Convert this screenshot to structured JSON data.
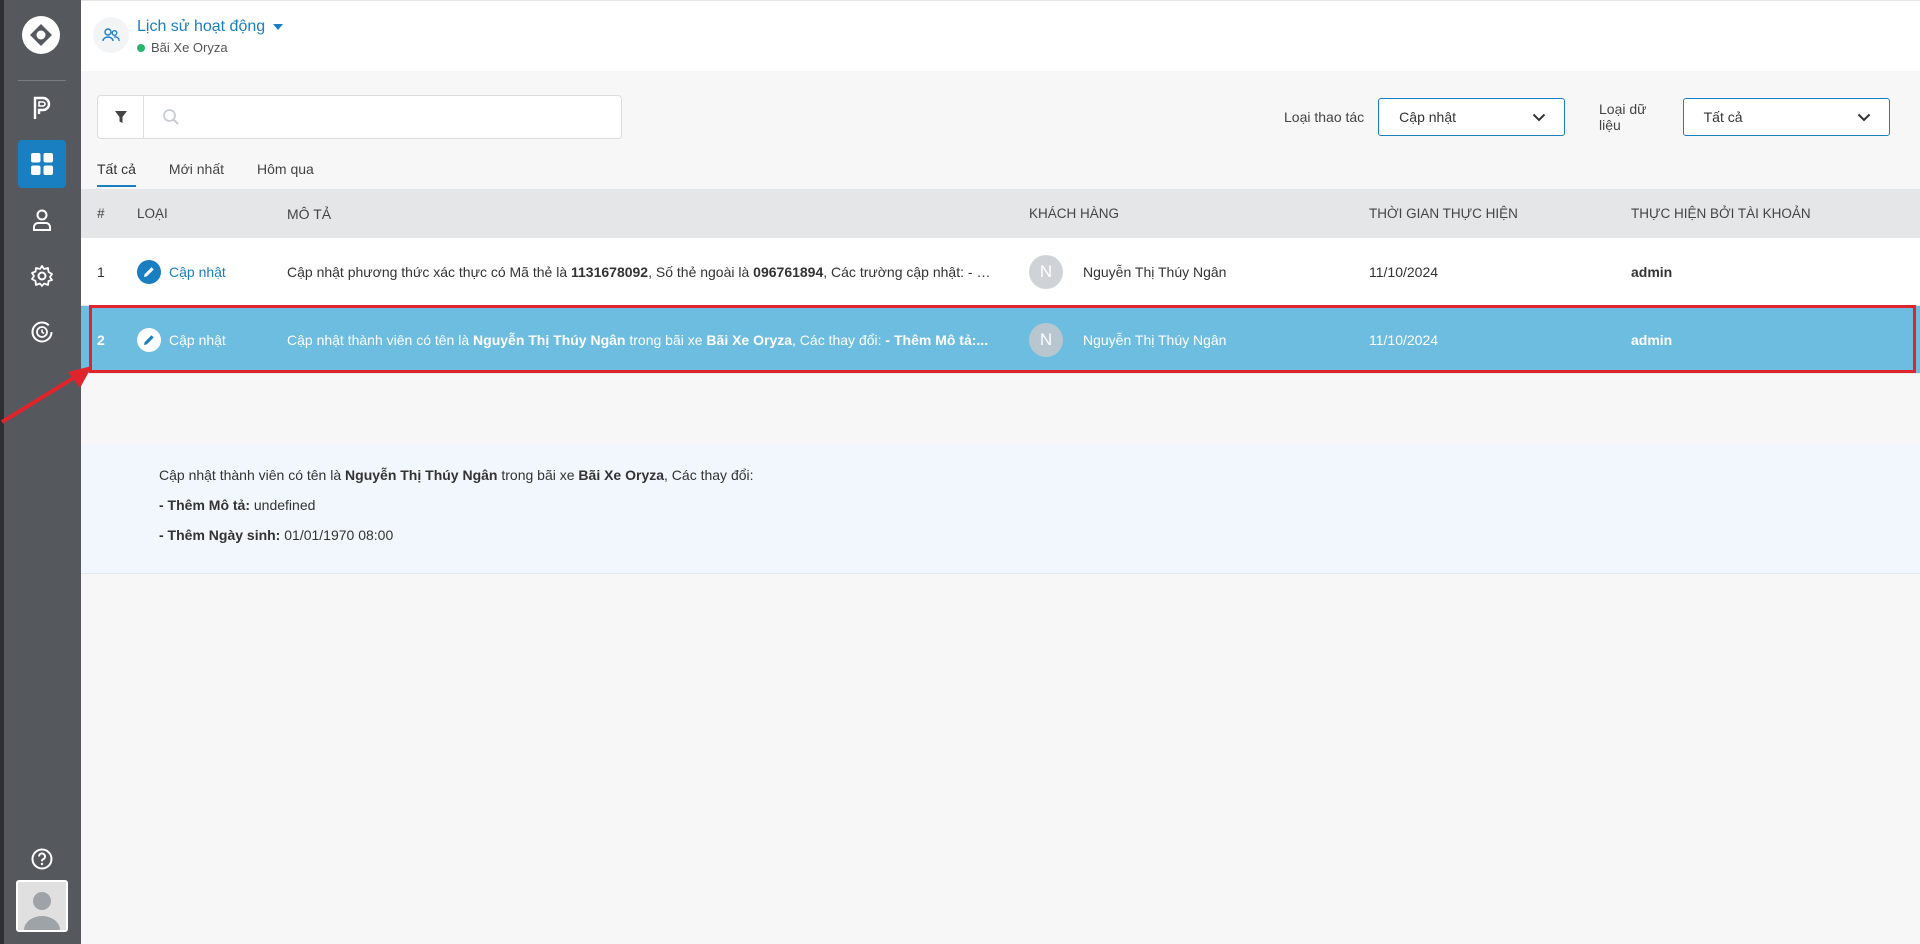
{
  "header": {
    "title": "Lịch sử hoạt động",
    "subtitle": "Bãi Xe Oryza"
  },
  "toolbar": {
    "search_placeholder": "",
    "filter_action_label": "Loại thao tác",
    "filter_action_value": "Cập nhật",
    "filter_data_label": "Loại dữ liệu",
    "filter_data_value": "Tất cả"
  },
  "tabs": [
    {
      "label": "Tất cả",
      "active": true
    },
    {
      "label": "Mới nhất",
      "active": false
    },
    {
      "label": "Hôm qua",
      "active": false
    }
  ],
  "table": {
    "columns": [
      "#",
      "LOẠI",
      "MÔ TẢ",
      "KHÁCH HÀNG",
      "THỜI GIAN THỰC HIỆN",
      "THỰC HIỆN BỞI TÀI KHOẢN"
    ],
    "rows": [
      {
        "index": "1",
        "type": "Cập nhật",
        "desc_parts": [
          "Cập nhật phương thức xác thực có Mã thẻ là ",
          "1131678092",
          ", Số thẻ ngoài là ",
          "096761894",
          ", Các trường cập nhật: - Ản..."
        ],
        "avatar": "N",
        "customer": "Nguyễn Thị Thúy Ngân",
        "time": "11/10/2024",
        "account": "admin"
      },
      {
        "index": "2",
        "type": "Cập nhật",
        "desc_parts": [
          "Cập nhật thành viên có tên là ",
          "Nguyễn Thị Thúy Ngân",
          " trong bãi xe ",
          "Bãi Xe Oryza",
          ", Các thay đổi: ",
          "- Thêm Mô tả:..."
        ],
        "avatar": "N",
        "customer": "Nguyễn Thị Thúy Ngân",
        "time": "11/10/2024",
        "account": "admin"
      }
    ]
  },
  "detail": {
    "line1": [
      "Cập nhật thành viên có tên là ",
      "Nguyễn Thị Thúy Ngân",
      " trong bãi xe ",
      "Bãi Xe Oryza",
      ", Các thay đổi:"
    ],
    "line2_label": "- Thêm Mô tả:",
    "line2_value": " undefined",
    "line3_label": "- Thêm Ngày sinh:",
    "line3_value": " 01/01/1970 08:00"
  },
  "icons": {
    "logo": "oryza-logo-icon",
    "parking": "parking-icon",
    "dashboard": "dashboard-grid-icon",
    "user": "user-icon",
    "settings": "gear-icon",
    "history": "history-clock-icon",
    "help": "help-icon"
  },
  "colors": {
    "accent": "#1a7fc1",
    "sidebar": "#55595e",
    "selected_row": "#6cbde0",
    "highlight_frame": "#e0242b"
  }
}
